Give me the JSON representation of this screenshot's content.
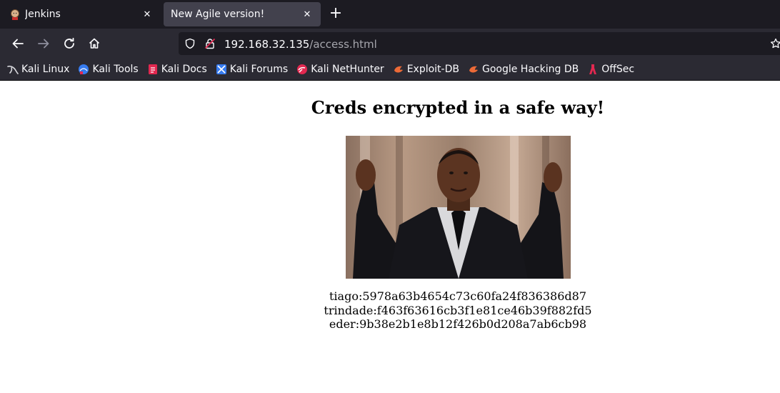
{
  "tabs": [
    {
      "title": "Jenkins",
      "active": false,
      "icon": "jenkins-icon"
    },
    {
      "title": "New Agile version!",
      "active": true
    }
  ],
  "navbar": {
    "url_host": "192.168.32.135",
    "url_path": "/access.html"
  },
  "bookmarks": [
    {
      "label": "Kali Linux",
      "icon": "kali-linux-icon"
    },
    {
      "label": "Kali Tools",
      "icon": "kali-tools-icon"
    },
    {
      "label": "Kali Docs",
      "icon": "kali-docs-icon"
    },
    {
      "label": "Kali Forums",
      "icon": "kali-forums-icon"
    },
    {
      "label": "Kali NetHunter",
      "icon": "kali-nethunter-icon"
    },
    {
      "label": "Exploit-DB",
      "icon": "exploit-db-icon"
    },
    {
      "label": "Google Hacking DB",
      "icon": "ghdb-icon"
    },
    {
      "label": "OffSec",
      "icon": "offsec-icon"
    }
  ],
  "page": {
    "title": "Creds encrypted in a safe way!",
    "credentials": [
      "tiago:5978a63b4654c73c60fa24f836386d87",
      "trindade:f463f63616cb3f1e81ce46b39f882fd5",
      "eder:9b38e2b1e8b12f426b0d208a7ab6cb98"
    ]
  },
  "colors": {
    "tab_strip": "#1c1b22",
    "toolbar": "#2b2a33",
    "active_tab": "#42414d",
    "text_light": "#fbfbfe",
    "url_path": "#a6a6ad",
    "page_bg": "#ffffff"
  }
}
